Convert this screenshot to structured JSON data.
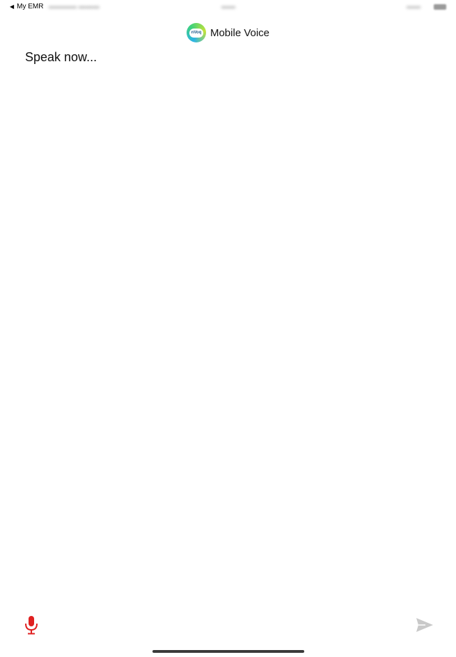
{
  "status_bar": {
    "back_label": "My EMR",
    "back_arrow": "◀"
  },
  "header": {
    "logo_text": "nVoq",
    "title": "Mobile Voice"
  },
  "main": {
    "prompt": "Speak now..."
  },
  "icons": {
    "mic": "microphone-icon",
    "send": "send-icon"
  },
  "colors": {
    "mic": "#e02020",
    "send_disabled": "#c9c9c9"
  }
}
